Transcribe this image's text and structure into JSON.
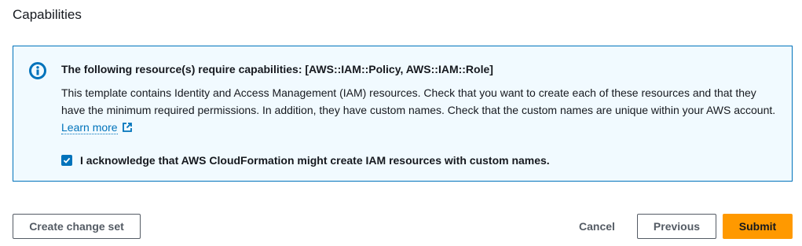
{
  "section": {
    "title": "Capabilities"
  },
  "alert": {
    "icon": "info-icon",
    "heading": "The following resource(s) require capabilities: [AWS::IAM::Policy, AWS::IAM::Role]",
    "body": "This template contains Identity and Access Management (IAM) resources. Check that you want to create each of these resources and that they have the minimum required permissions. In addition, they have custom names. Check that the custom names are unique within your AWS account.",
    "link_label": "Learn more",
    "link_icon": "external-link-icon",
    "acknowledge_label": "I acknowledge that AWS CloudFormation might create IAM resources with custom names.",
    "acknowledge_checked": true
  },
  "actions": {
    "create_change_set": "Create change set",
    "cancel": "Cancel",
    "previous": "Previous",
    "submit": "Submit"
  },
  "colors": {
    "accent": "#0073bb",
    "primary_button": "#ff9900",
    "alert_background": "#f1faff"
  }
}
